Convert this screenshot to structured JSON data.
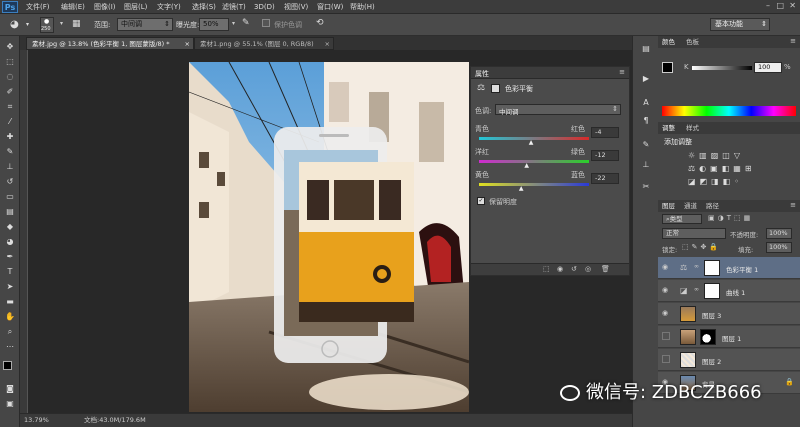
{
  "app_logo": "Ps",
  "menu": [
    "文件(F)",
    "编辑(E)",
    "图像(I)",
    "图层(L)",
    "文字(Y)",
    "选择(S)",
    "滤镜(T)",
    "3D(D)",
    "视图(V)",
    "窗口(W)",
    "帮助(H)"
  ],
  "options": {
    "brush_size": "250",
    "mode_label": "范围:",
    "mode_value": "中间调",
    "exposure_label": "曝光度:",
    "exposure_value": "50%",
    "protect_label": "保护色调",
    "workspace": "基本功能"
  },
  "tabs": [
    {
      "label": "素材.jpg @ 13.8% (色彩平衡 1, 图层蒙版/8) *"
    },
    {
      "label": "素材1.png @ 55.1% (图层 0, RGB/8)"
    }
  ],
  "status": {
    "zoom": "13.79%",
    "doc": "文档:43.0M/179.6M"
  },
  "properties": {
    "title": "属性",
    "adjustment_name": "色彩平衡",
    "tone_label": "色调:",
    "tone_value": "中间调",
    "sliders": [
      {
        "left": "青色",
        "right": "红色",
        "value": "-4",
        "pos": 0.48
      },
      {
        "left": "洋红",
        "right": "绿色",
        "value": "-12",
        "pos": 0.44
      },
      {
        "left": "黄色",
        "right": "蓝色",
        "value": "-22",
        "pos": 0.39
      }
    ],
    "preserve_label": "保留明度",
    "preserve_checked": true
  },
  "color_panel": {
    "tab1": "颜色",
    "tab2": "色板",
    "channel": "K",
    "value": "100"
  },
  "adjust_panel": {
    "tab1": "调整",
    "tab2": "样式",
    "title": "添加调整"
  },
  "layers_panel": {
    "tabs": [
      "图层",
      "通道",
      "路径"
    ],
    "filter": "类型",
    "blend": "正常",
    "opacity_label": "不透明度:",
    "opacity": "100%",
    "lock_label": "锁定:",
    "fill_label": "填充:",
    "fill": "100%",
    "layers": [
      {
        "name": "色彩平衡 1",
        "selected": true,
        "visible": true
      },
      {
        "name": "曲线 1",
        "selected": false,
        "visible": true
      },
      {
        "name": "图层 3",
        "selected": false,
        "visible": true
      },
      {
        "name": "图层 1",
        "selected": false,
        "visible": false
      },
      {
        "name": "图层 2",
        "selected": false,
        "visible": false
      },
      {
        "name": "背景",
        "selected": false,
        "visible": true
      }
    ]
  },
  "watermark": "微信号: ZDBCZB666"
}
